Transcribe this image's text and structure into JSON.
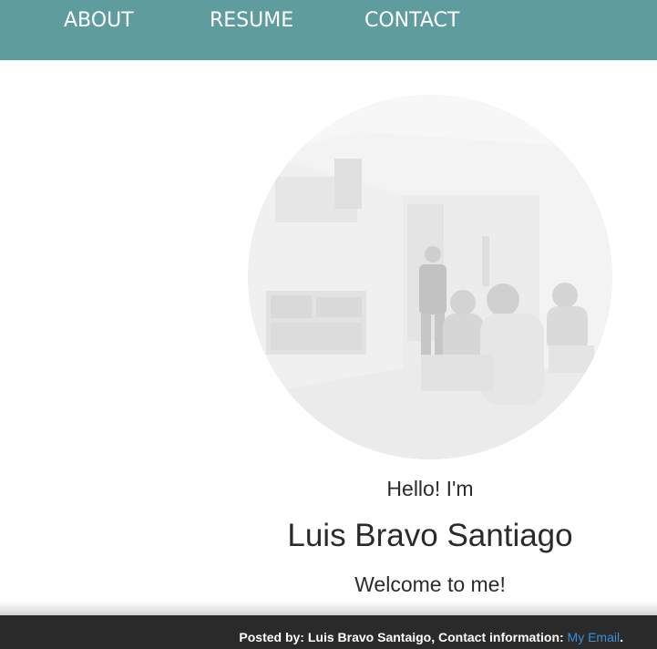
{
  "nav": {
    "items": [
      {
        "label": "ABOUT"
      },
      {
        "label": "RESUME"
      },
      {
        "label": "CONTACT"
      }
    ],
    "background_color": "#5e9c9e"
  },
  "hero": {
    "photo_icon": "profile-photo-presentation",
    "greeting": "Hello! I'm",
    "name": "Luis Bravo Santiago",
    "tagline": "Welcome to me!"
  },
  "footer": {
    "posted_by": "Posted by: Luis Bravo Santaigo, Contact information: ",
    "email_link": "My Email",
    "trailing": ".",
    "background_color": "#2a2a2a",
    "link_color": "#3d8fd6"
  }
}
